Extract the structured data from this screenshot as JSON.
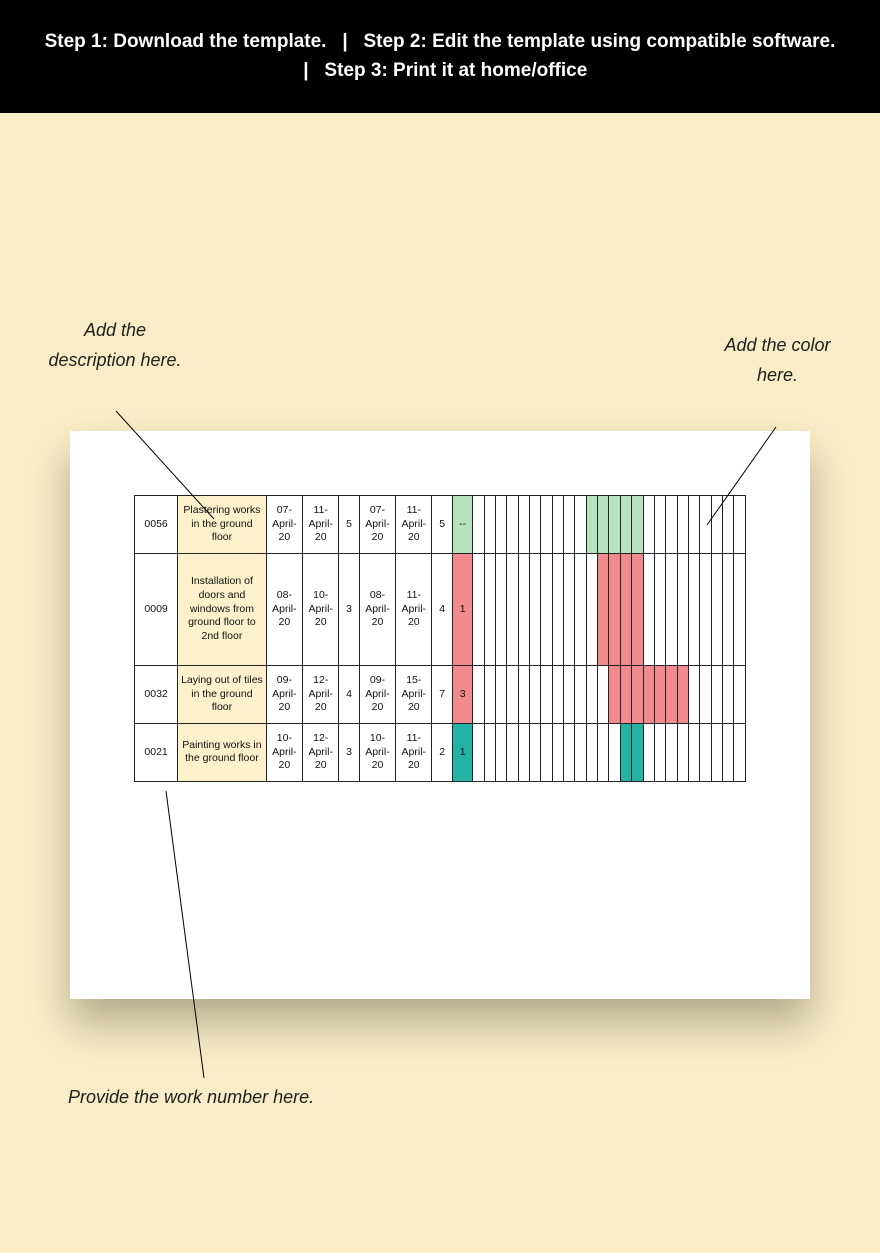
{
  "banner": {
    "step1": "Step 1: Download the template.",
    "sep1": "|",
    "step2": "Step 2: Edit the template using compatible software.",
    "sep2": "|",
    "step3": "Step 3: Print it at home/office"
  },
  "callouts": {
    "description": "Add the description here.",
    "color": "Add the color here.",
    "worknum": "Provide the work number here."
  },
  "chart_data": {
    "type": "table",
    "title": "Work schedule / Gantt table",
    "num_day_columns": 24,
    "rows": [
      {
        "id": "0056",
        "description": "Plastering works in the ground floor",
        "planned_start": "07-April-20",
        "planned_end": "11-April-20",
        "planned_duration": 5,
        "actual_start": "07-April-20",
        "actual_end": "11-April-20",
        "actual_duration": 5,
        "variance": "--",
        "variance_fill": "fill-green",
        "bar": {
          "start": 11,
          "length": 5,
          "fill": "fill-green"
        }
      },
      {
        "id": "0009",
        "description": "Installation of doors and windows from ground floor to 2nd floor",
        "planned_start": "08-April-20",
        "planned_end": "10-April-20",
        "planned_duration": 3,
        "actual_start": "08-April-20",
        "actual_end": "11-April-20",
        "actual_duration": 4,
        "variance": "1",
        "variance_fill": "fill-red",
        "bar": {
          "start": 12,
          "length": 4,
          "fill": "fill-red"
        }
      },
      {
        "id": "0032",
        "description": "Laying out of tiles in the ground floor",
        "planned_start": "09-April-20",
        "planned_end": "12-April-20",
        "planned_duration": 4,
        "actual_start": "09-April-20",
        "actual_end": "15-April-20",
        "actual_duration": 7,
        "variance": "3",
        "variance_fill": "fill-red",
        "bar": {
          "start": 13,
          "length": 7,
          "fill": "fill-red"
        }
      },
      {
        "id": "0021",
        "description": "Painting works in the ground floor",
        "planned_start": "10-April-20",
        "planned_end": "12-April-20",
        "planned_duration": 3,
        "actual_start": "10-April-20",
        "actual_end": "11-April-20",
        "actual_duration": 2,
        "variance": "1",
        "variance_fill": "fill-teal",
        "bar": {
          "start": 14,
          "length": 2,
          "fill": "fill-teal"
        }
      }
    ]
  }
}
